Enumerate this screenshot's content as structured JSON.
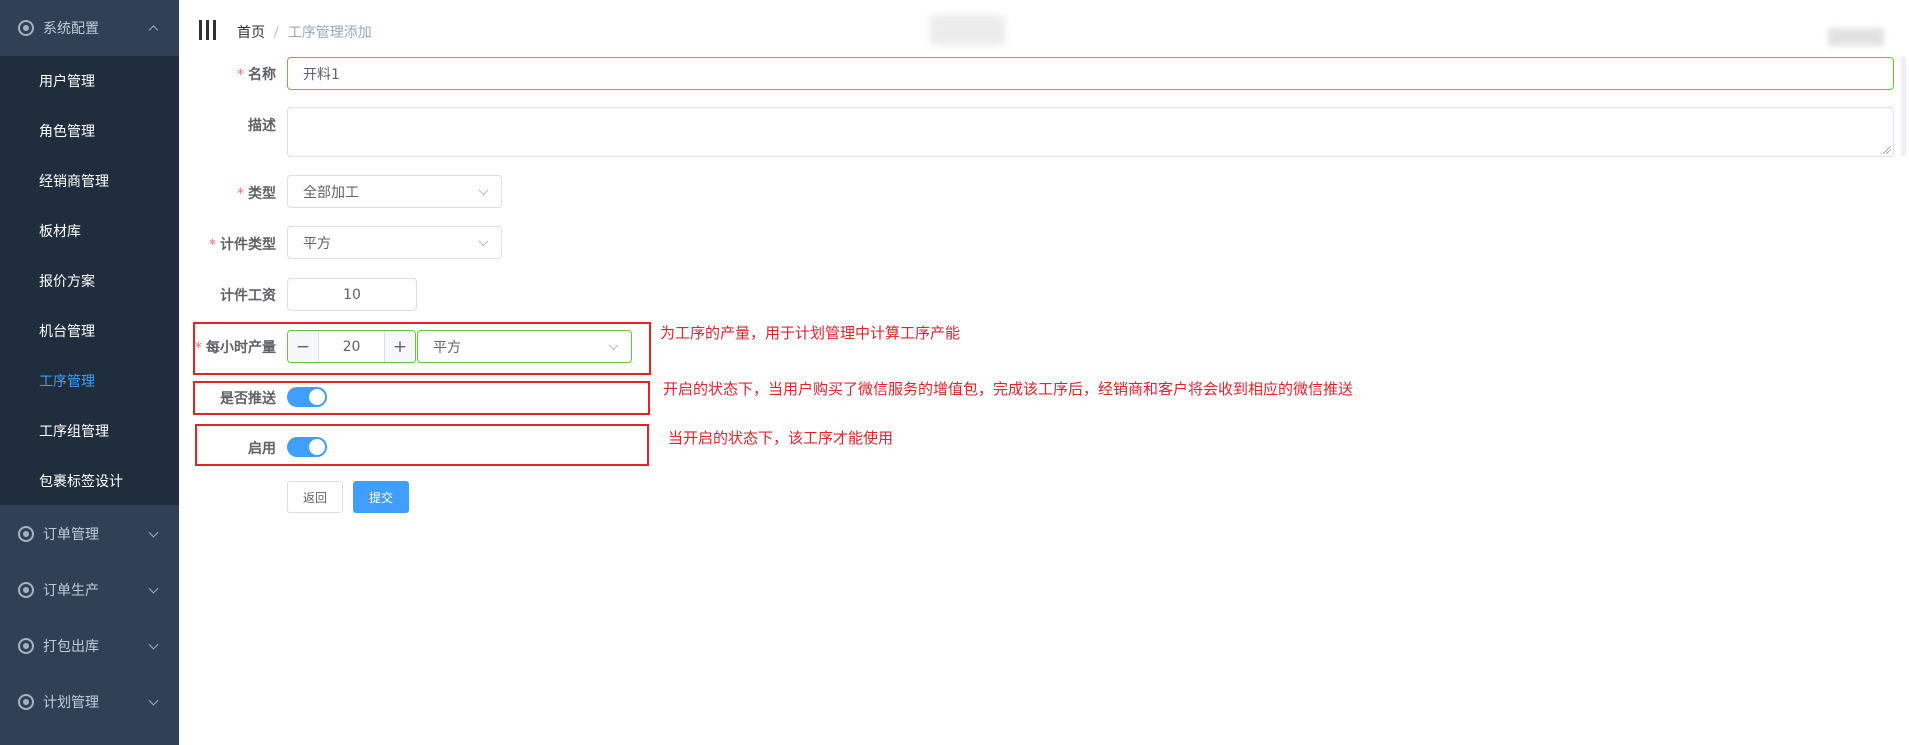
{
  "sidebar": {
    "groups": [
      {
        "label": "系统配置",
        "expanded": true
      },
      {
        "label": "订单管理",
        "expanded": false
      },
      {
        "label": "订单生产",
        "expanded": false
      },
      {
        "label": "打包出库",
        "expanded": false
      },
      {
        "label": "计划管理",
        "expanded": false
      }
    ],
    "items": [
      {
        "label": "用户管理"
      },
      {
        "label": "角色管理"
      },
      {
        "label": "经销商管理"
      },
      {
        "label": "板材库"
      },
      {
        "label": "报价方案"
      },
      {
        "label": "机台管理"
      },
      {
        "label": "工序管理",
        "active": true
      },
      {
        "label": "工序组管理"
      },
      {
        "label": "包裹标签设计"
      }
    ]
  },
  "header": {
    "breadcrumb": {
      "home": "首页",
      "separator": "/",
      "current": "工序管理添加"
    }
  },
  "form": {
    "name": {
      "label": "名称",
      "value": "开料1",
      "required": true
    },
    "description": {
      "label": "描述",
      "value": ""
    },
    "type": {
      "label": "类型",
      "value": "全部加工",
      "required": true
    },
    "piece_type": {
      "label": "计件类型",
      "value": "平方",
      "required": true
    },
    "piece_wage": {
      "label": "计件工资",
      "value": "10"
    },
    "hourly_output": {
      "label": "每小时产量",
      "value": "20",
      "unit": "平方",
      "minus": "−",
      "plus": "+",
      "required": true
    },
    "push": {
      "label": "是否推送",
      "on": true
    },
    "enabled": {
      "label": "启用",
      "on": true
    },
    "back_label": "返回",
    "submit_label": "提交"
  },
  "annotations": {
    "hourly_output": "为工序的产量，用于计划管理中计算工序产能",
    "push": "开启的状态下，当用户购买了微信服务的增值包，完成该工序后，经销商和客户将会收到相应的微信推送",
    "enabled": "当开启的状态下，该工序才能使用"
  },
  "colors": {
    "sidebar_bg": "#304156",
    "submenu_bg": "#1f2d3d",
    "accent": "#409eff",
    "success_border": "#67c23a",
    "annotation_red": "#e0232c"
  }
}
